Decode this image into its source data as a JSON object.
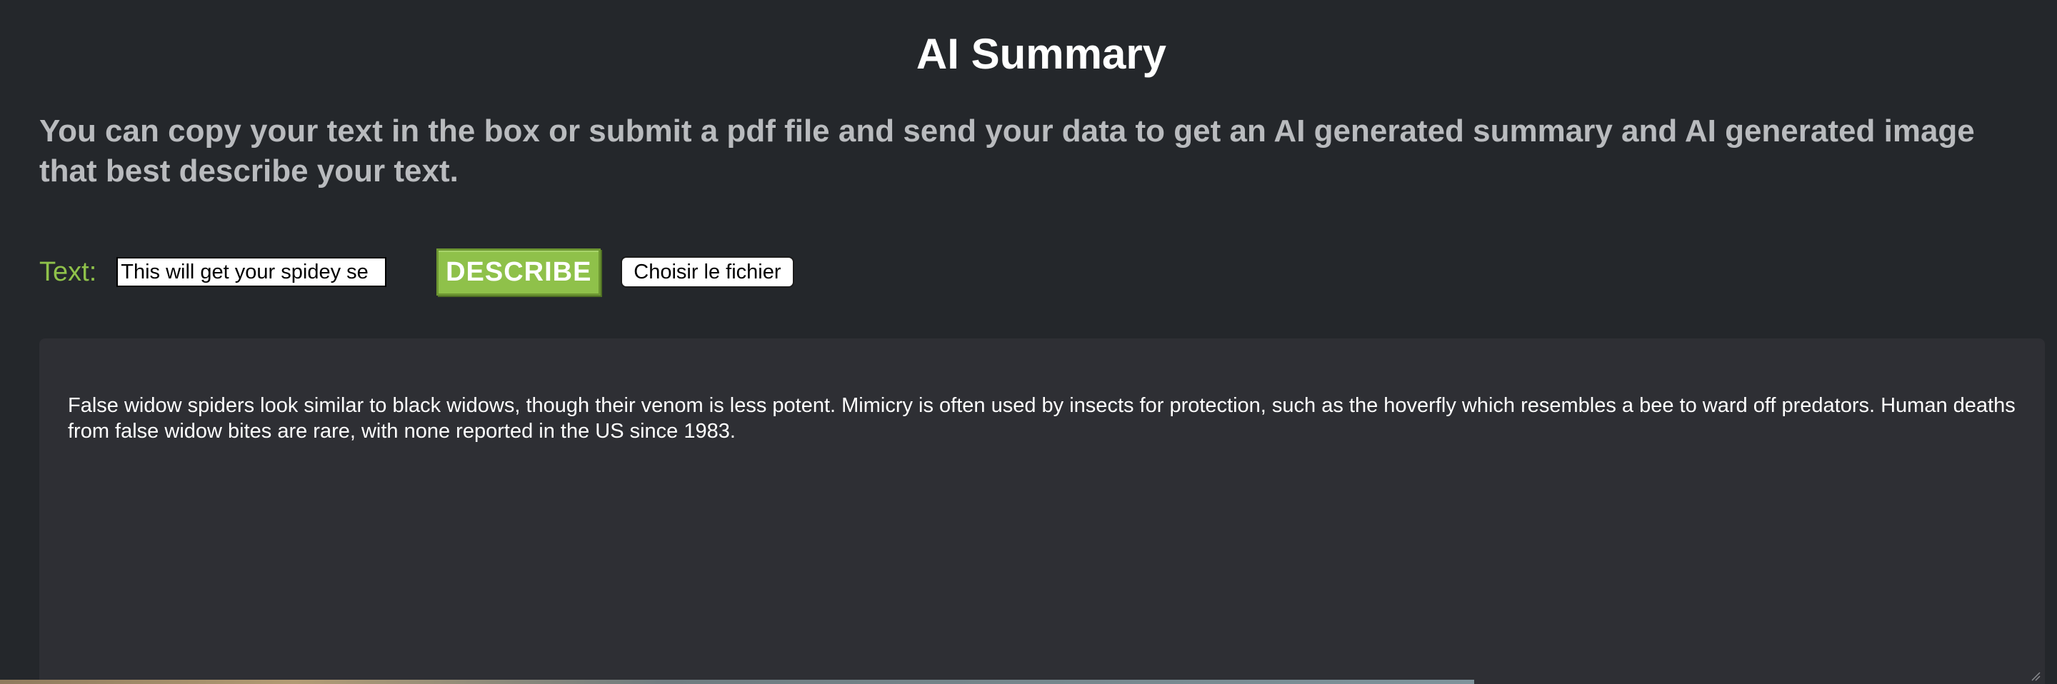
{
  "header": {
    "title": "AI Summary",
    "intro": "You can copy your text in the box or submit a pdf file and send your data to get an AI generated summary and AI generated image that best describe your text."
  },
  "form": {
    "text_label": "Text:",
    "text_value": "This will get your spidey se",
    "describe_label": "DESCRIBE",
    "file_label": "Choisir le fichier"
  },
  "summary": {
    "text": "False widow spiders look similar to black widows, though their venom is less potent. Mimicry is often used by insects for protection, such as the hoverfly which resembles a bee to ward off predators. Human deaths from false widow bites are rare, with none reported in the US since 1983."
  },
  "colors": {
    "background": "#24272b",
    "accent": "#8fc14a",
    "summary_background": "#2e2f34"
  }
}
